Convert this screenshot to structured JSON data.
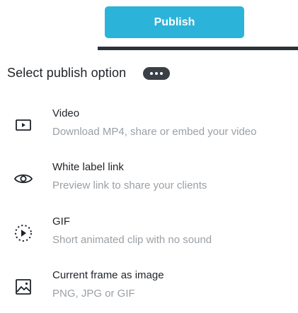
{
  "toolbar": {
    "publish_label": "Publish"
  },
  "panel": {
    "title": "Select publish option",
    "more_icon": "more-dots-icon",
    "options": [
      {
        "icon": "video-play-icon",
        "title": "Video",
        "description": "Download MP4, share or embed your video"
      },
      {
        "icon": "eye-icon",
        "title": "White label link",
        "description": "Preview link to share your clients"
      },
      {
        "icon": "gif-play-icon",
        "title": "GIF",
        "description": "Short animated clip with no sound"
      },
      {
        "icon": "image-icon",
        "title": "Current frame as image",
        "description": "PNG, JPG or GIF"
      }
    ]
  },
  "colors": {
    "accent": "#2cb3d9",
    "text_primary": "#1f2328",
    "text_secondary": "#9aa0a6",
    "badge": "#3b4046"
  }
}
